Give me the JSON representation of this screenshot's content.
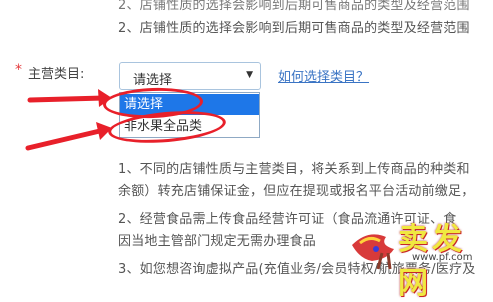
{
  "notes": {
    "top_clipped": "2、店铺性质的选择会影响到后期可售商品的类型及经营范围",
    "top": "2、店铺性质的选择会影响到后期可售商品的类型及经营范围",
    "n1_line1": "1、不同的店铺性质与主营类目，将关系到上传商品的种类和",
    "n1_line2": "余额）转充店铺保证金，但应在提现或报名平台活动前缴足，",
    "n2_line1": "2、经营食品需上传食品经营许可证（食品流通许可证、食",
    "n2_line2": "因当地主管部门规定无需办理食品",
    "n3_line1": "3、如您想咨询虚拟产品(充值业务/会员特权/航旅票务/医疗及"
  },
  "form": {
    "required_mark": "*",
    "field_label": "主营类目:",
    "select_value": "请选择",
    "select_arrow": "▼",
    "help_link": "如何选择类目？"
  },
  "dropdown": {
    "options": [
      "请选择",
      "非水果全品类"
    ],
    "selected_index": 0
  },
  "watermark": {
    "text": "卖发网",
    "url": "www.pf.com"
  },
  "colors": {
    "link": "#3a74c4",
    "required": "#e4393c",
    "selected_bg": "#1e77e8",
    "annotation": "#e8202a"
  }
}
